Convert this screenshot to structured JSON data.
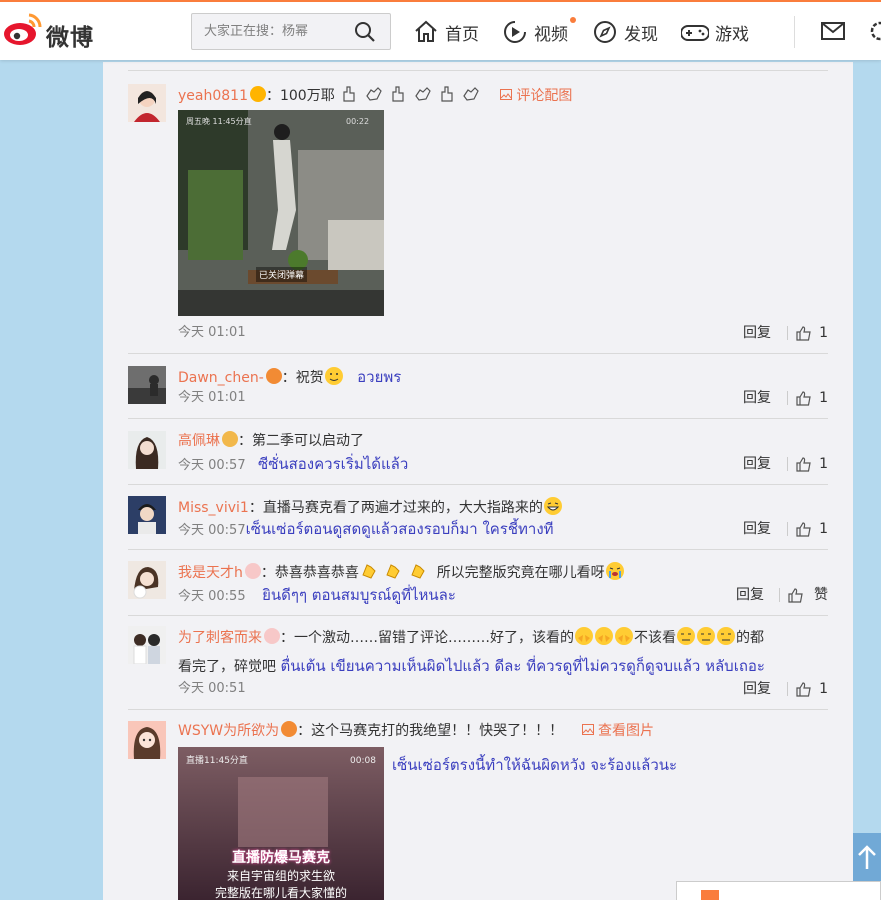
{
  "topbar": {
    "logo_text": "微博",
    "search_placeholder": "大家正在搜：杨幂",
    "nav": [
      {
        "label": "首页",
        "icon": "home-icon"
      },
      {
        "label": "视频",
        "icon": "video-icon"
      },
      {
        "label": "发现",
        "icon": "compass-icon"
      },
      {
        "label": "游戏",
        "icon": "gamepad-icon"
      }
    ]
  },
  "comments": [
    {
      "user": "yeah0811",
      "text": "：100万耶",
      "link": "评论配图",
      "time": "今天 01:01",
      "reply": "回复",
      "likes": "1",
      "thai": "",
      "image_caption": "已关闭弹幕"
    },
    {
      "user": "Dawn_chen-",
      "text": "：祝贺",
      "thai": "อวยพร",
      "time": "今天 01:01",
      "reply": "回复",
      "likes": "1"
    },
    {
      "user": "高佩琳",
      "text": "：第二季可以启动了",
      "thai": "ซีซั่นสองควรเริ่มได้แล้ว",
      "time": "今天 00:57",
      "reply": "回复",
      "likes": "1"
    },
    {
      "user": "Miss_vivi1",
      "text": "：直播马赛克看了两遍才过来的，大大指路来的",
      "thai": "เซ็นเซ่อร์ตอนดูสดดูแล้วสองรอบก็มา  ใครชี้ทางที",
      "time": "今天 00:57",
      "reply": "回复",
      "likes": "1"
    },
    {
      "user": "我是天才h",
      "text": "：恭喜恭喜恭喜",
      "text2": "所以完整版究竟在哪儿看呀",
      "thai": "ยินดีๆๆ  ตอนสมบูรณ์ดูที่ไหนละ",
      "time": "今天 00:55",
      "reply": "回复",
      "likes": "赞"
    },
    {
      "user": "为了刺客而来",
      "text": "：一个激动……留错了评论………好了，该看的",
      "text_mid": "不该看",
      "text_end": "的都",
      "line2": "看完了，碎觉吧",
      "thai": "ตื่นเต้น เขียนความเห็นผิดไปแล้ว ดีละ  ที่ควรดูที่ไม่ควรดูก็ดูจบแล้ว หลับเถอะ",
      "time": "今天 00:51",
      "reply": "回复",
      "likes": "1"
    },
    {
      "user": "WSYW为所欲为",
      "text": "：这个马赛克打的我绝望！！快哭了！！！",
      "link": "查看图片",
      "thai": "เซ็นเซ่อร์ตรงนี้ทำให้ฉันผิดหวัง จะร้องแล้วนะ",
      "image_title": "直播防爆马赛克",
      "image_sub1": "来自宇宙组的求生欲",
      "image_sub2": "完整版在哪儿看大家懂的"
    }
  ],
  "colors": {
    "accent": "#fa7d3c",
    "username": "#eb7350",
    "thai": "#3b3fbf",
    "background": "#b4d9ee"
  }
}
